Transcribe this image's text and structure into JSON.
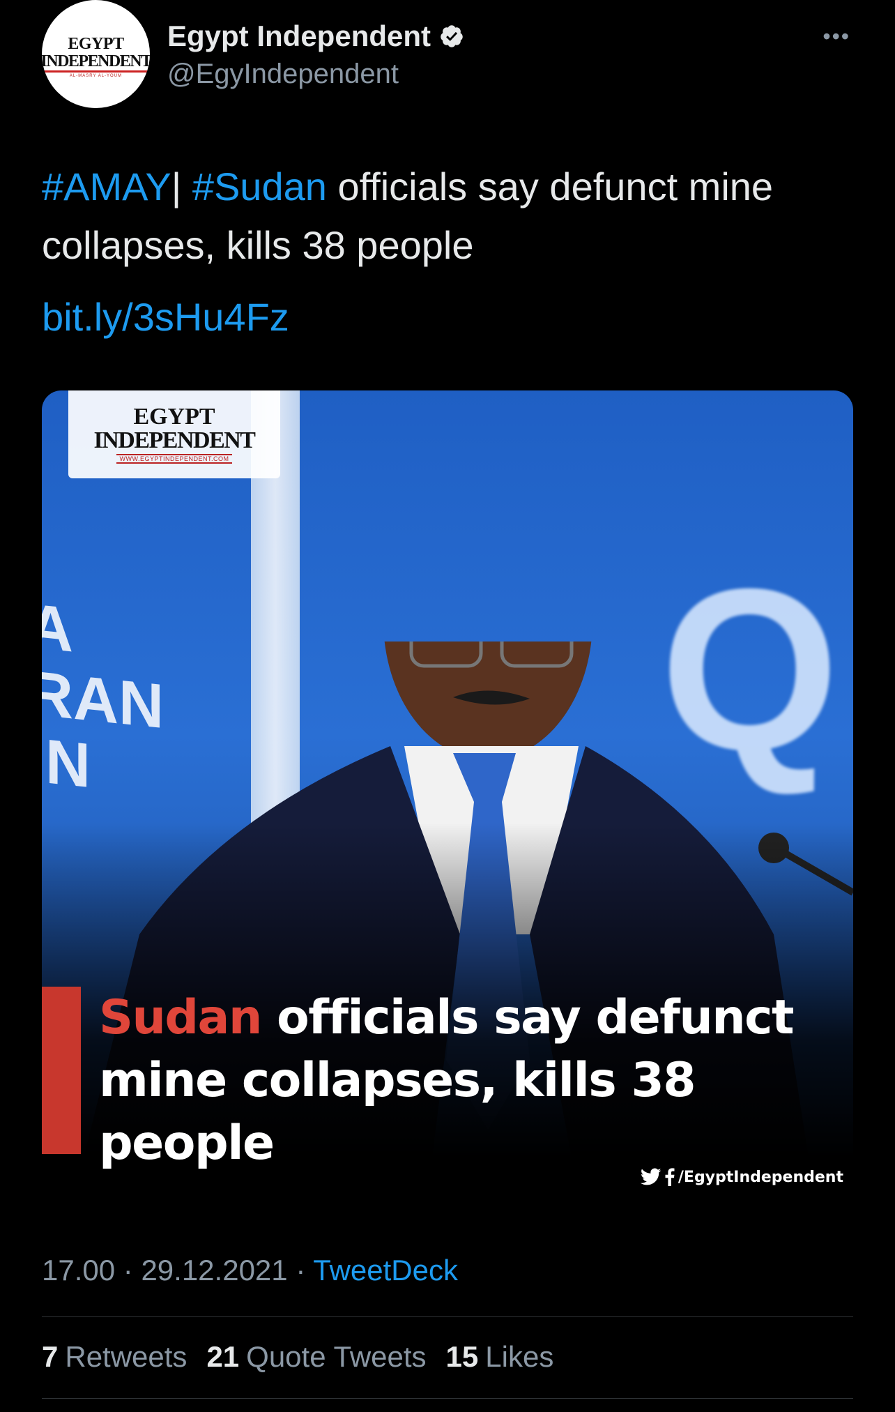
{
  "tweet": {
    "author": {
      "display_name": "Egypt Independent",
      "handle": "@EgyIndependent",
      "verified": true,
      "avatar_text": [
        "EGYPT",
        "INDEPENDENT",
        "AL-MASRY AL-YOUM"
      ]
    },
    "more_label": "•••",
    "text": {
      "hashtag1": "#AMAY",
      "separator": "| ",
      "hashtag2": "#Sudan",
      "body": " officials say defunct mine collapses, kills 38 people",
      "link": "bit.ly/3sHu4Fz"
    },
    "media": {
      "watermark": [
        "EGYPT",
        "INDEPENDENT",
        "WWW.EGYPTINDEPENDENT.COM"
      ],
      "headline_highlight": "Sudan",
      "headline_rest": " officials say defunct mine collapses, kills 38 people",
      "social_handle": "/EgyptIndependent",
      "background_sign_text": [
        "A",
        "RAN",
        "IN"
      ],
      "background_letter": "Q"
    },
    "meta": {
      "time": "17.00",
      "date": "29.12.2021",
      "source": "TweetDeck"
    },
    "stats": {
      "retweets_count": "7",
      "retweets_label": "Retweets",
      "quotes_count": "21",
      "quotes_label": "Quote Tweets",
      "likes_count": "15",
      "likes_label": "Likes"
    }
  },
  "colors": {
    "background": "#000000",
    "link": "#1d9bf0",
    "secondary_text": "#8b98a5",
    "primary_text": "#e7e9ea",
    "accent_red": "#c8372d"
  }
}
